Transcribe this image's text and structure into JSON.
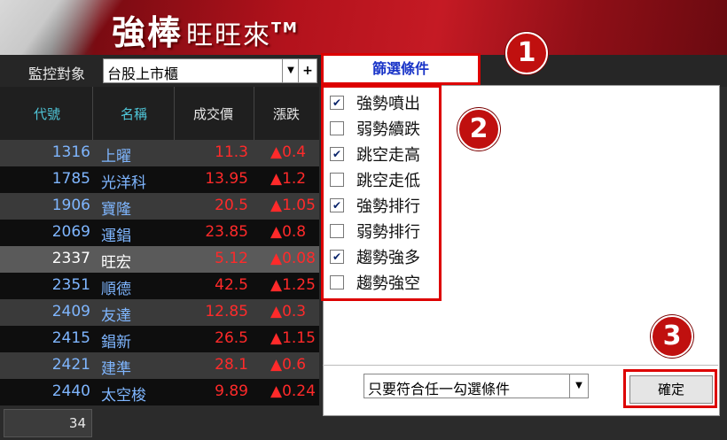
{
  "header": {
    "logo_main": "強棒",
    "logo_sub": "旺旺來",
    "logo_tm": "TM"
  },
  "monitor": {
    "label": "監控對象",
    "value": "台股上市櫃",
    "plus": "+",
    "arrow": "▼"
  },
  "filter_button": "篩選條件",
  "table": {
    "headers": [
      "代號",
      "名稱",
      "成交價",
      "漲跌"
    ],
    "rows": [
      {
        "code": "1316",
        "name": "上曜",
        "price": "11.3",
        "change": "▲0.4"
      },
      {
        "code": "1785",
        "name": "光洋科",
        "price": "13.95",
        "change": "▲1.2"
      },
      {
        "code": "1906",
        "name": "寶隆",
        "price": "20.5",
        "change": "▲1.05"
      },
      {
        "code": "2069",
        "name": "運錩",
        "price": "23.85",
        "change": "▲0.8"
      },
      {
        "code": "2337",
        "name": "旺宏",
        "price": "5.12",
        "change": "▲0.08"
      },
      {
        "code": "2351",
        "name": "順德",
        "price": "42.5",
        "change": "▲1.25"
      },
      {
        "code": "2409",
        "name": "友達",
        "price": "12.85",
        "change": "▲0.3"
      },
      {
        "code": "2415",
        "name": "錩新",
        "price": "26.5",
        "change": "▲1.15"
      },
      {
        "code": "2421",
        "name": "建準",
        "price": "28.1",
        "change": "▲0.6"
      },
      {
        "code": "2440",
        "name": "太空梭",
        "price": "9.89",
        "change": "▲0.24"
      }
    ],
    "count": "34"
  },
  "conditions": [
    {
      "label": "強勢噴出",
      "checked": true
    },
    {
      "label": "弱勢續跌",
      "checked": false
    },
    {
      "label": "跳空走高",
      "checked": true
    },
    {
      "label": "跳空走低",
      "checked": false
    },
    {
      "label": "強勢排行",
      "checked": true
    },
    {
      "label": "弱勢排行",
      "checked": false
    },
    {
      "label": "趨勢強多",
      "checked": true
    },
    {
      "label": "趨勢強空",
      "checked": false
    }
  ],
  "mode_select": {
    "value": "只要符合任一勾選條件",
    "arrow": "▼"
  },
  "ok_button": "確定",
  "badges": [
    "1",
    "2",
    "3"
  ],
  "colors": {
    "accent_red": "#d00000",
    "up_red": "#ff2a2a",
    "code_blue": "#7fb6ff",
    "filter_blue": "#1a35c8"
  }
}
